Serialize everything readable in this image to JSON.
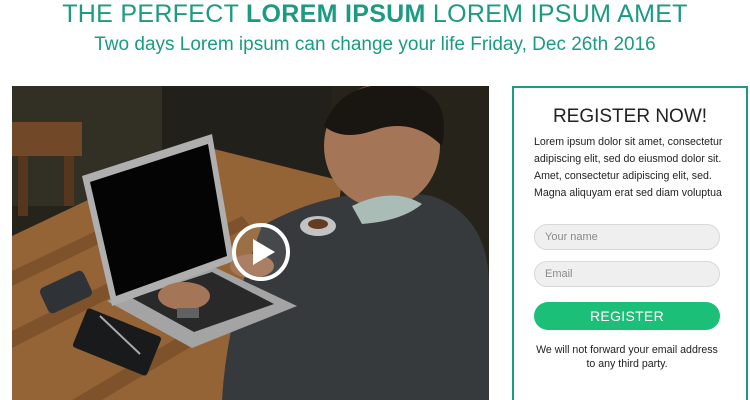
{
  "header": {
    "title_prefix": "THE PERFECT ",
    "title_bold": "LOREM IPSUM",
    "title_suffix": " LOREM IPSUM AMET",
    "subtitle": "Two days Lorem ipsum can change your life Friday, Dec 26th 2016"
  },
  "video": {
    "play_icon": "play-icon",
    "play_button_color": "#ffffff"
  },
  "register": {
    "title": "REGISTER NOW!",
    "description": "Lorem ipsum dolor sit amet, consectetur adipiscing elit, sed do eiusmod dolor sit. Amet, consectetur adipiscing elit, sed. Magna aliquyam erat sed diam voluptua",
    "name_placeholder": "Your name",
    "email_placeholder": "Email",
    "button_label": "REGISTER",
    "privacy_note": "We will not forward your email address to any third party."
  },
  "colors": {
    "accent": "#1a9b82",
    "button": "#1cbf77"
  }
}
